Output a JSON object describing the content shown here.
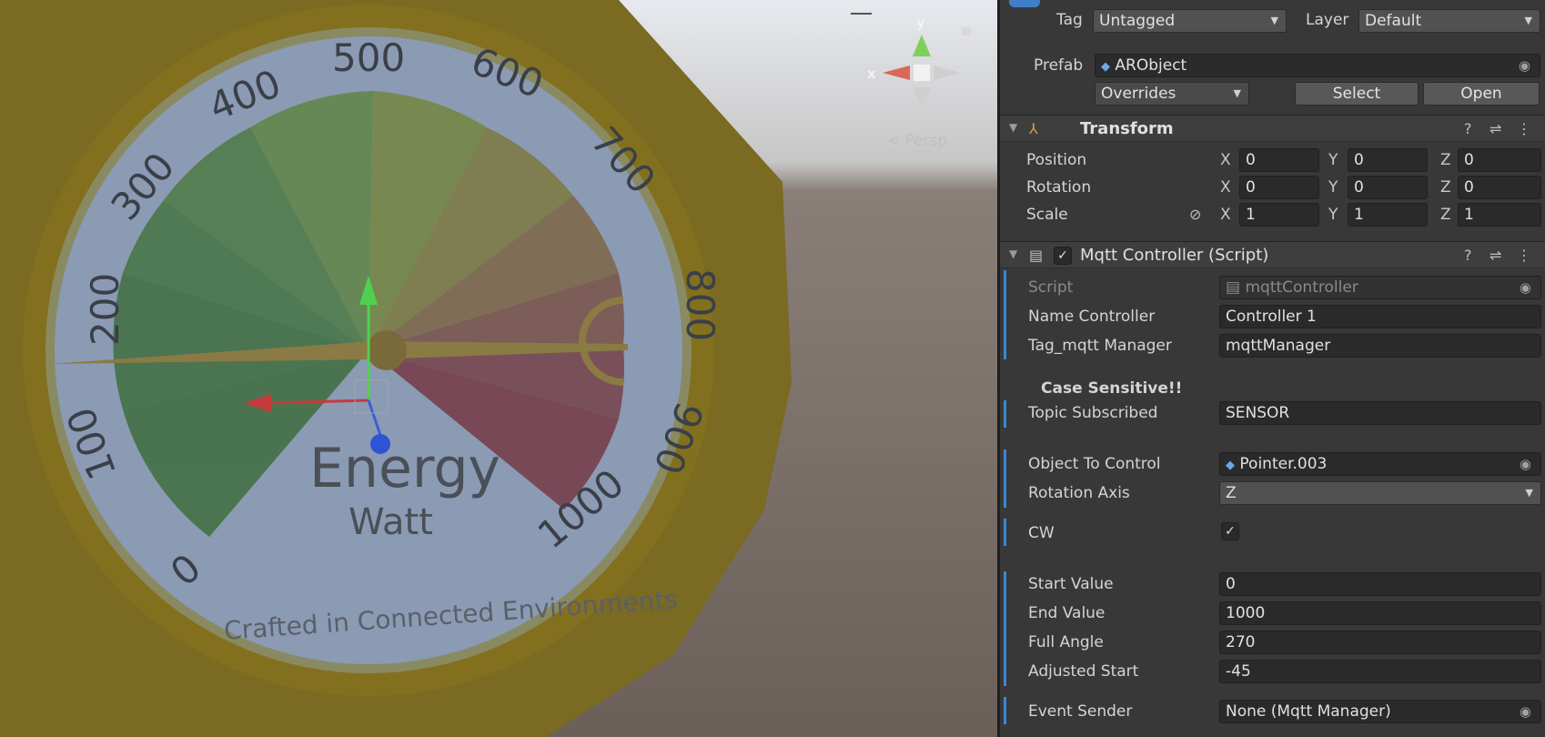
{
  "scene": {
    "gizmo_axis_y": "y",
    "gizmo_axis_x": "x",
    "view_label": "< Persp",
    "gauge": {
      "ticks": [
        "0",
        "100",
        "200",
        "300",
        "400",
        "500",
        "600",
        "700",
        "800",
        "900",
        "1000"
      ],
      "title": "Energy",
      "unit": "Watt",
      "footer": "Crafted in Connected Environments"
    }
  },
  "inspector": {
    "tag_label": "Tag",
    "tag_value": "Untagged",
    "layer_label": "Layer",
    "layer_value": "Default",
    "prefab_label": "Prefab",
    "prefab_value": "ARObject",
    "overrides_label": "Overrides",
    "select_label": "Select",
    "open_label": "Open",
    "transform": {
      "title": "Transform",
      "position_label": "Position",
      "rotation_label": "Rotation",
      "scale_label": "Scale",
      "x": "X",
      "y": "Y",
      "z": "Z",
      "position": [
        "0",
        "0",
        "0"
      ],
      "rotation": [
        "0",
        "0",
        "0"
      ],
      "scale": [
        "1",
        "1",
        "1"
      ]
    },
    "mqtt": {
      "title": "Mqtt Controller (Script)",
      "script_label": "Script",
      "script_value": "mqttController",
      "name_controller_label": "Name Controller",
      "name_controller_value": "Controller 1",
      "tag_manager_label": "Tag_mqtt Manager",
      "tag_manager_value": "mqttManager",
      "case_note": "Case Sensitive!!",
      "topic_label": "Topic Subscribed",
      "topic_value": "SENSOR",
      "object_label": "Object To Control",
      "object_value": "Pointer.003",
      "axis_label": "Rotation Axis",
      "axis_value": "Z",
      "cw_label": "CW",
      "cw_checked": "✓",
      "start_label": "Start Value",
      "start_value": "0",
      "end_label": "End Value",
      "end_value": "1000",
      "full_angle_label": "Full Angle",
      "full_angle_value": "270",
      "adjusted_label": "Adjusted Start",
      "adjusted_value": "-45",
      "event_label": "Event Sender",
      "event_value": "None (Mqtt Manager)"
    }
  }
}
